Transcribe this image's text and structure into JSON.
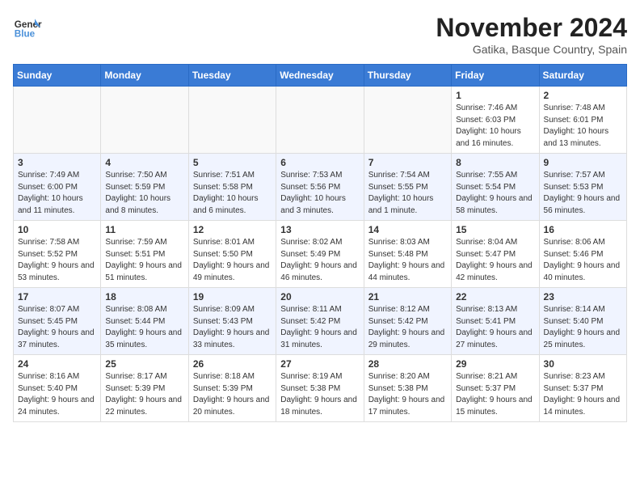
{
  "logo": {
    "line1": "General",
    "line2": "Blue"
  },
  "title": "November 2024",
  "location": "Gatika, Basque Country, Spain",
  "days_of_week": [
    "Sunday",
    "Monday",
    "Tuesday",
    "Wednesday",
    "Thursday",
    "Friday",
    "Saturday"
  ],
  "weeks": [
    [
      {
        "day": "",
        "info": ""
      },
      {
        "day": "",
        "info": ""
      },
      {
        "day": "",
        "info": ""
      },
      {
        "day": "",
        "info": ""
      },
      {
        "day": "",
        "info": ""
      },
      {
        "day": "1",
        "info": "Sunrise: 7:46 AM\nSunset: 6:03 PM\nDaylight: 10 hours and 16 minutes."
      },
      {
        "day": "2",
        "info": "Sunrise: 7:48 AM\nSunset: 6:01 PM\nDaylight: 10 hours and 13 minutes."
      }
    ],
    [
      {
        "day": "3",
        "info": "Sunrise: 7:49 AM\nSunset: 6:00 PM\nDaylight: 10 hours and 11 minutes."
      },
      {
        "day": "4",
        "info": "Sunrise: 7:50 AM\nSunset: 5:59 PM\nDaylight: 10 hours and 8 minutes."
      },
      {
        "day": "5",
        "info": "Sunrise: 7:51 AM\nSunset: 5:58 PM\nDaylight: 10 hours and 6 minutes."
      },
      {
        "day": "6",
        "info": "Sunrise: 7:53 AM\nSunset: 5:56 PM\nDaylight: 10 hours and 3 minutes."
      },
      {
        "day": "7",
        "info": "Sunrise: 7:54 AM\nSunset: 5:55 PM\nDaylight: 10 hours and 1 minute."
      },
      {
        "day": "8",
        "info": "Sunrise: 7:55 AM\nSunset: 5:54 PM\nDaylight: 9 hours and 58 minutes."
      },
      {
        "day": "9",
        "info": "Sunrise: 7:57 AM\nSunset: 5:53 PM\nDaylight: 9 hours and 56 minutes."
      }
    ],
    [
      {
        "day": "10",
        "info": "Sunrise: 7:58 AM\nSunset: 5:52 PM\nDaylight: 9 hours and 53 minutes."
      },
      {
        "day": "11",
        "info": "Sunrise: 7:59 AM\nSunset: 5:51 PM\nDaylight: 9 hours and 51 minutes."
      },
      {
        "day": "12",
        "info": "Sunrise: 8:01 AM\nSunset: 5:50 PM\nDaylight: 9 hours and 49 minutes."
      },
      {
        "day": "13",
        "info": "Sunrise: 8:02 AM\nSunset: 5:49 PM\nDaylight: 9 hours and 46 minutes."
      },
      {
        "day": "14",
        "info": "Sunrise: 8:03 AM\nSunset: 5:48 PM\nDaylight: 9 hours and 44 minutes."
      },
      {
        "day": "15",
        "info": "Sunrise: 8:04 AM\nSunset: 5:47 PM\nDaylight: 9 hours and 42 minutes."
      },
      {
        "day": "16",
        "info": "Sunrise: 8:06 AM\nSunset: 5:46 PM\nDaylight: 9 hours and 40 minutes."
      }
    ],
    [
      {
        "day": "17",
        "info": "Sunrise: 8:07 AM\nSunset: 5:45 PM\nDaylight: 9 hours and 37 minutes."
      },
      {
        "day": "18",
        "info": "Sunrise: 8:08 AM\nSunset: 5:44 PM\nDaylight: 9 hours and 35 minutes."
      },
      {
        "day": "19",
        "info": "Sunrise: 8:09 AM\nSunset: 5:43 PM\nDaylight: 9 hours and 33 minutes."
      },
      {
        "day": "20",
        "info": "Sunrise: 8:11 AM\nSunset: 5:42 PM\nDaylight: 9 hours and 31 minutes."
      },
      {
        "day": "21",
        "info": "Sunrise: 8:12 AM\nSunset: 5:42 PM\nDaylight: 9 hours and 29 minutes."
      },
      {
        "day": "22",
        "info": "Sunrise: 8:13 AM\nSunset: 5:41 PM\nDaylight: 9 hours and 27 minutes."
      },
      {
        "day": "23",
        "info": "Sunrise: 8:14 AM\nSunset: 5:40 PM\nDaylight: 9 hours and 25 minutes."
      }
    ],
    [
      {
        "day": "24",
        "info": "Sunrise: 8:16 AM\nSunset: 5:40 PM\nDaylight: 9 hours and 24 minutes."
      },
      {
        "day": "25",
        "info": "Sunrise: 8:17 AM\nSunset: 5:39 PM\nDaylight: 9 hours and 22 minutes."
      },
      {
        "day": "26",
        "info": "Sunrise: 8:18 AM\nSunset: 5:39 PM\nDaylight: 9 hours and 20 minutes."
      },
      {
        "day": "27",
        "info": "Sunrise: 8:19 AM\nSunset: 5:38 PM\nDaylight: 9 hours and 18 minutes."
      },
      {
        "day": "28",
        "info": "Sunrise: 8:20 AM\nSunset: 5:38 PM\nDaylight: 9 hours and 17 minutes."
      },
      {
        "day": "29",
        "info": "Sunrise: 8:21 AM\nSunset: 5:37 PM\nDaylight: 9 hours and 15 minutes."
      },
      {
        "day": "30",
        "info": "Sunrise: 8:23 AM\nSunset: 5:37 PM\nDaylight: 9 hours and 14 minutes."
      }
    ]
  ]
}
